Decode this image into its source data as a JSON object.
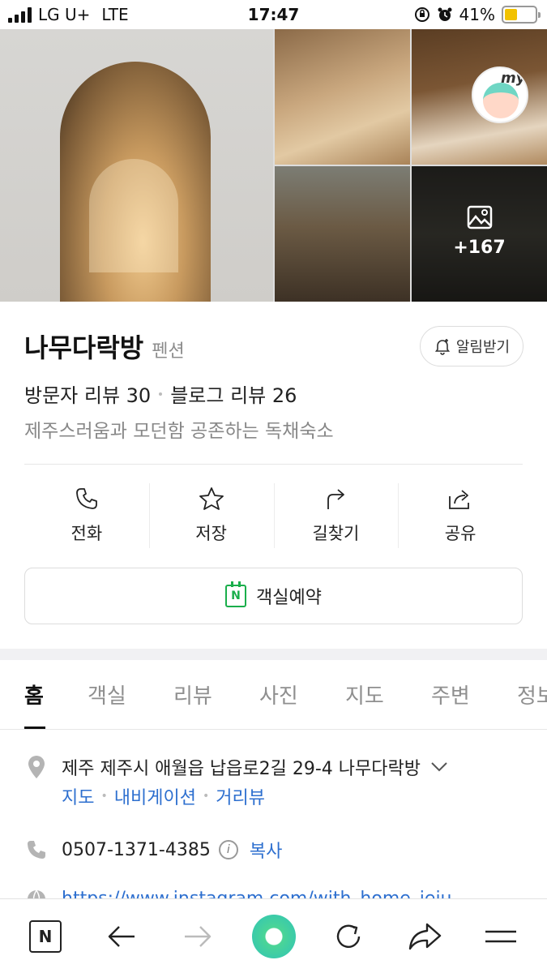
{
  "status_bar": {
    "carrier": "LG U+",
    "network": "LTE",
    "time": "17:47",
    "battery": "41%",
    "battery_level": 0.41
  },
  "photos": {
    "more_count": "+167",
    "badge_text": "my"
  },
  "place": {
    "name": "나무다락방",
    "category": "펜션",
    "notify_label": "알림받기",
    "visitor_reviews": "방문자 리뷰 30",
    "blog_reviews": "블로그 리뷰 26",
    "description": "제주스러움과 모던함 공존하는 독채숙소"
  },
  "actions": [
    {
      "label": "전화",
      "icon": "phone-icon"
    },
    {
      "label": "저장",
      "icon": "star-icon"
    },
    {
      "label": "길찾기",
      "icon": "directions-icon"
    },
    {
      "label": "공유",
      "icon": "share-icon"
    }
  ],
  "reserve": {
    "label": "객실예약",
    "icon_letter": "N",
    "accent": "#1aae4b"
  },
  "tabs": [
    "홈",
    "객실",
    "리뷰",
    "사진",
    "지도",
    "주변",
    "정보"
  ],
  "details": {
    "address": "제주 제주시 애월읍 납읍로2길 29-4 나무다락방",
    "links": [
      "지도",
      "내비게이션",
      "거리뷰"
    ],
    "phone": "0507-1371-4385",
    "copy_label": "복사",
    "website": "https://www.instagram.com/with_home_jeju"
  },
  "colors": {
    "link": "#2d6fcf",
    "divider": "#e6e6e6"
  }
}
